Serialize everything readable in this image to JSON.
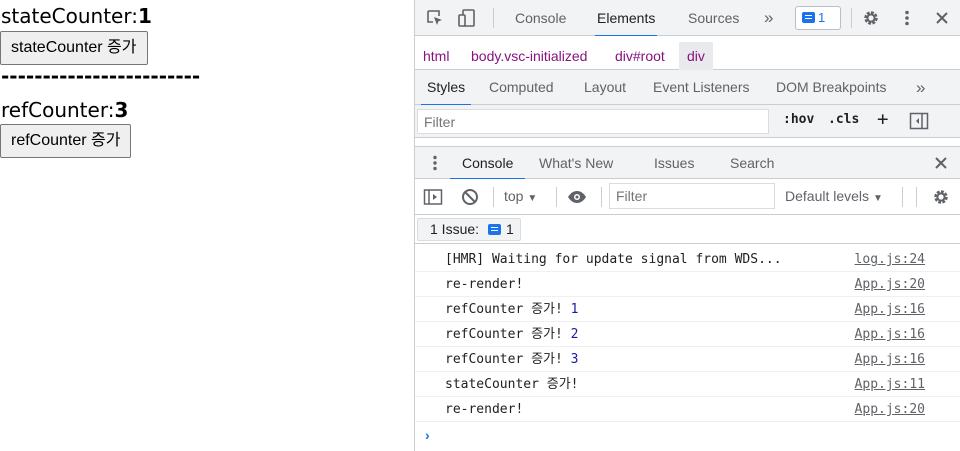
{
  "page": {
    "state_label": "stateCounter:",
    "state_value": "1",
    "state_button": "stateCounter 증가",
    "divider": "------------------------",
    "ref_label": "refCounter:",
    "ref_value": "3",
    "ref_button": "refCounter 증가"
  },
  "devtools": {
    "tabs": [
      "Console",
      "Elements",
      "Sources"
    ],
    "active_tab": "Elements",
    "more": "»",
    "issues_badge": "1",
    "breadcrumb": [
      "html",
      "body.vsc-initialized",
      "div#root",
      "div"
    ],
    "styles_tabs": [
      "Styles",
      "Computed",
      "Layout",
      "Event Listeners",
      "DOM Breakpoints"
    ],
    "styles_more": "»",
    "styles_filter_placeholder": "Filter",
    "hov": ":hov",
    "cls": ".cls",
    "add": "+",
    "drawer_tabs": [
      "Console",
      "What's New",
      "Issues",
      "Search"
    ],
    "context": "top",
    "console_filter_placeholder": "Filter",
    "levels": "Default levels",
    "issue_label": "1 Issue:",
    "issue_count": "1",
    "log": [
      {
        "text": "[HMR] Waiting for update signal from WDS...",
        "num": "",
        "src": "log.js:24"
      },
      {
        "text": "re-render!",
        "num": "",
        "src": "App.js:20"
      },
      {
        "text": "refCounter 증가! ",
        "num": "1",
        "src": "App.js:16"
      },
      {
        "text": "refCounter 증가! ",
        "num": "2",
        "src": "App.js:16"
      },
      {
        "text": "refCounter 증가! ",
        "num": "3",
        "src": "App.js:16"
      },
      {
        "text": "stateCounter 증가!",
        "num": "",
        "src": "App.js:11"
      },
      {
        "text": "re-render!",
        "num": "",
        "src": "App.js:20"
      }
    ],
    "prompt": "›"
  },
  "colors": {
    "accent": "#1a73e8",
    "breadcrumb": "#881280",
    "number": "#1a1aa6"
  }
}
